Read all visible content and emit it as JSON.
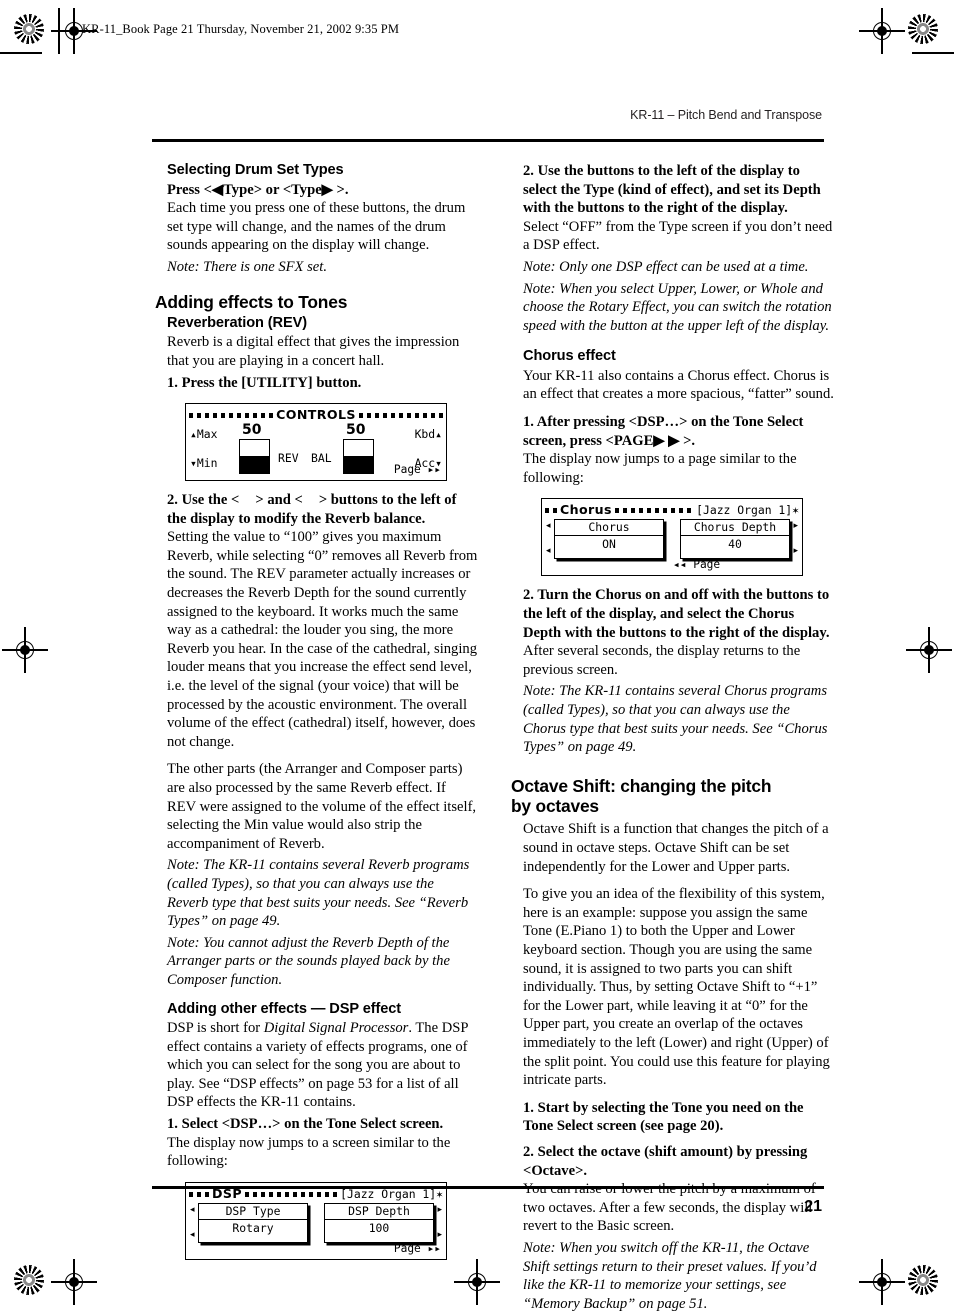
{
  "print_slug": "KR-11_Book  Page 21  Thursday, November 21, 2002  9:35 PM",
  "running_head": "KR-11 – Pitch Bend and Transpose",
  "folio": "21",
  "left_column": {
    "drum_heading": "Selecting Drum Set Types",
    "drum_press": "Press <◀Type> or <Type▶ >.",
    "drum_body": "Each time you press one of these buttons, the drum set type will change, and the names of the drum sounds appearing on the display will change.",
    "drum_note": "Note: There is one SFX set.",
    "effects_heading": "Adding effects to Tones",
    "rev_heading": "Reverberation (REV)",
    "rev_body": "Reverb is a digital effect that gives the impression that you are playing in a concert hall.",
    "rev_step1": "1. Press the [UTILITY] button.",
    "rev_step2_a": "2. Use the <",
    "rev_step2_b": "> and <",
    "rev_step2_c": "> buttons to the left of the display to modify the Reverb balance.",
    "rev_p1": "Setting the value to “100” gives you maximum Reverb, while selecting “0” removes all Reverb from the sound. The REV parameter actually increases or decreases the Reverb Depth for the sound currently assigned to the keyboard. It works much the same way as a cathedral: the louder you sing, the more Reverb you hear. In the case of the cathedral, singing louder means that you increase the effect send level, i.e. the level of the signal (your voice) that will be processed by the acoustic environment. The overall volume of the effect (cathedral) itself, however, does not change.",
    "rev_p2": "The other parts (the Arranger and Composer parts) are also processed by the same Reverb effect. If REV were assigned to the volume of the effect itself, selecting the Min value would also strip the accompaniment of Reverb.",
    "rev_note1": "Note: The KR-11 contains several Reverb programs (called Types), so that you can always use the Reverb type that best suits your needs. See “Reverb Types” on page 49.",
    "rev_note2": "Note: You cannot adjust the Reverb Depth of the Arranger parts or the sounds played back by the Composer function.",
    "dsp_heading": "Adding other effects — DSP effect",
    "dsp_body_1": "DSP is short for ",
    "dsp_body_italic": "Digital Signal Processor",
    "dsp_body_2": ". The DSP effect contains a variety of effects programs, one of which you can select for the song you are about to play. See “DSP effects” on page 53 for a list of all DSP effects the KR-11 contains.",
    "dsp_step1": "1. Select <DSP…> on the Tone Select screen.",
    "dsp_after": "The display now jumps to a screen similar to the following:"
  },
  "controls_display": {
    "title": "CONTROLS",
    "max_label": "▴Max",
    "min_label": "▾Min",
    "kbd_label": "Kbd▴",
    "acc_label": "Acc▾",
    "left_value": "50",
    "right_value": "50",
    "left_name": "REV",
    "right_name": "BAL",
    "page_label": "Page  ▸▸"
  },
  "dsp_display": {
    "title": "DSP",
    "tone": "[Jazz Organ 1]✶",
    "left_box_title": "DSP Type",
    "left_box_value": "Rotary",
    "right_box_title": "DSP Depth",
    "right_box_value": "100",
    "page_label": "Page  ▸▸"
  },
  "chorus_display": {
    "title": "Chorus",
    "tone": "[Jazz Organ 1]✶",
    "left_box_title": "Chorus",
    "left_box_value": "ON",
    "right_box_title": "Chorus Depth",
    "right_box_value": "40",
    "page_label": "◂◂  Page"
  },
  "right_column": {
    "dsp_step2": "2. Use the buttons to the left of the display to select the Type (kind of effect), and set its Depth with the buttons to the right of the display.",
    "dsp_step2_body": "Select “OFF” from the Type screen if you don’t need a DSP effect.",
    "dsp_note1": "Note: Only one DSP effect can be used at a time.",
    "dsp_note2": "Note: When you select Upper, Lower, or Whole and choose the Rotary Effect, you can switch the rotation speed with the button at the upper left of the display.",
    "chorus_heading": "Chorus effect",
    "chorus_body": "Your KR-11 also contains a Chorus effect. Chorus is an effect that creates a more spacious, “fatter” sound.",
    "chorus_step1": "1. After pressing <DSP…> on the Tone Select screen, press <PAGE▶ ▶ >.",
    "chorus_after": "The display now jumps to a page similar to the following:",
    "chorus_step2": "2. Turn the Chorus on and off with the buttons to the left of the display, and select the Chorus Depth with the buttons to the right of the display.",
    "chorus_step2_body": "After several seconds, the display returns to the previous screen.",
    "chorus_note": "Note: The KR-11 contains several Chorus programs (called Types), so that you can always use the Chorus type that best suits your needs. See “Chorus Types” on page 49.",
    "octave_heading_line1": "Octave Shift: changing the pitch",
    "octave_heading_line2": "by octaves",
    "octave_p1": "Octave Shift is a function that changes the pitch of a sound in octave steps. Octave Shift can be set independently for the Lower and Upper parts.",
    "octave_p2": "To give you an idea of the flexibility of this system, here is an example: suppose you assign the same Tone (E.Piano 1) to both the Upper and Lower keyboard section. Though you are using the same sound, it is assigned to two parts you can shift individually. Thus, by setting Octave Shift to “+1” for the Lower part, while leaving it at “0” for the Upper part, you create an overlap of the octaves immediately to the left (Lower) and right (Upper) of the split point. You could use this feature for playing intricate parts.",
    "octave_step1": "1. Start by selecting the Tone you need on the Tone Select screen (see page 20).",
    "octave_step2": "2. Select the octave (shift amount) by pressing <Octave>.",
    "octave_step2_body": "You can raise or lower the pitch by a maximum of two octaves. After a few seconds, the display will revert to the Basic screen.",
    "octave_note": "Note: When you switch off the KR-11, the Octave Shift settings return to their preset values. If you’d like the KR-11 to memorize your settings, see “Memory Backup” on page 51."
  }
}
